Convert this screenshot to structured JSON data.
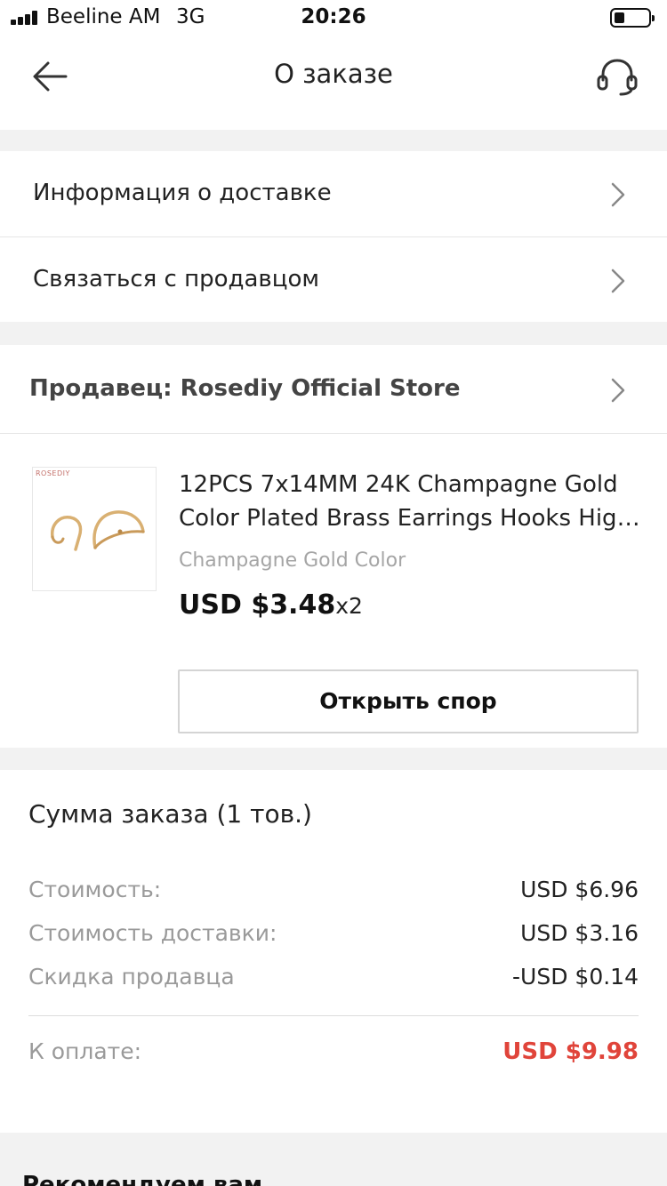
{
  "status_bar": {
    "carrier": "Beeline AM",
    "network": "3G",
    "time": "20:26",
    "battery_level": 0.3
  },
  "nav": {
    "title": "О заказе",
    "back_icon": "arrow-left-icon",
    "support_icon": "headset-icon"
  },
  "menu": {
    "delivery_info": "Информация о доставке",
    "contact_seller": "Связаться с продавцом"
  },
  "seller": {
    "label": "Продавец: Rosediy Official Store"
  },
  "product": {
    "image_brand": "ROSEDIY",
    "title": "12PCS 7x14MM 24K Champagne Gold Color Plated Brass Earrings Hooks High Quality Diy Jewelry Findings",
    "variant": "Champagne Gold Color",
    "price": "USD $3.48",
    "quantity": "x2",
    "dispute_button": "Открыть спор"
  },
  "summary": {
    "title": "Сумма заказа (1 тов.)",
    "lines": [
      {
        "label": "Стоимость:",
        "value": "USD $6.96"
      },
      {
        "label": "Стоимость доставки:",
        "value": "USD $3.16"
      },
      {
        "label": "Скидка продавца",
        "value": "-USD $0.14"
      }
    ],
    "total_label": "К оплате:",
    "total_value": "USD $9.98",
    "total_color": "#e0443a"
  },
  "recommend": {
    "title": "Рекомендуем вам"
  }
}
